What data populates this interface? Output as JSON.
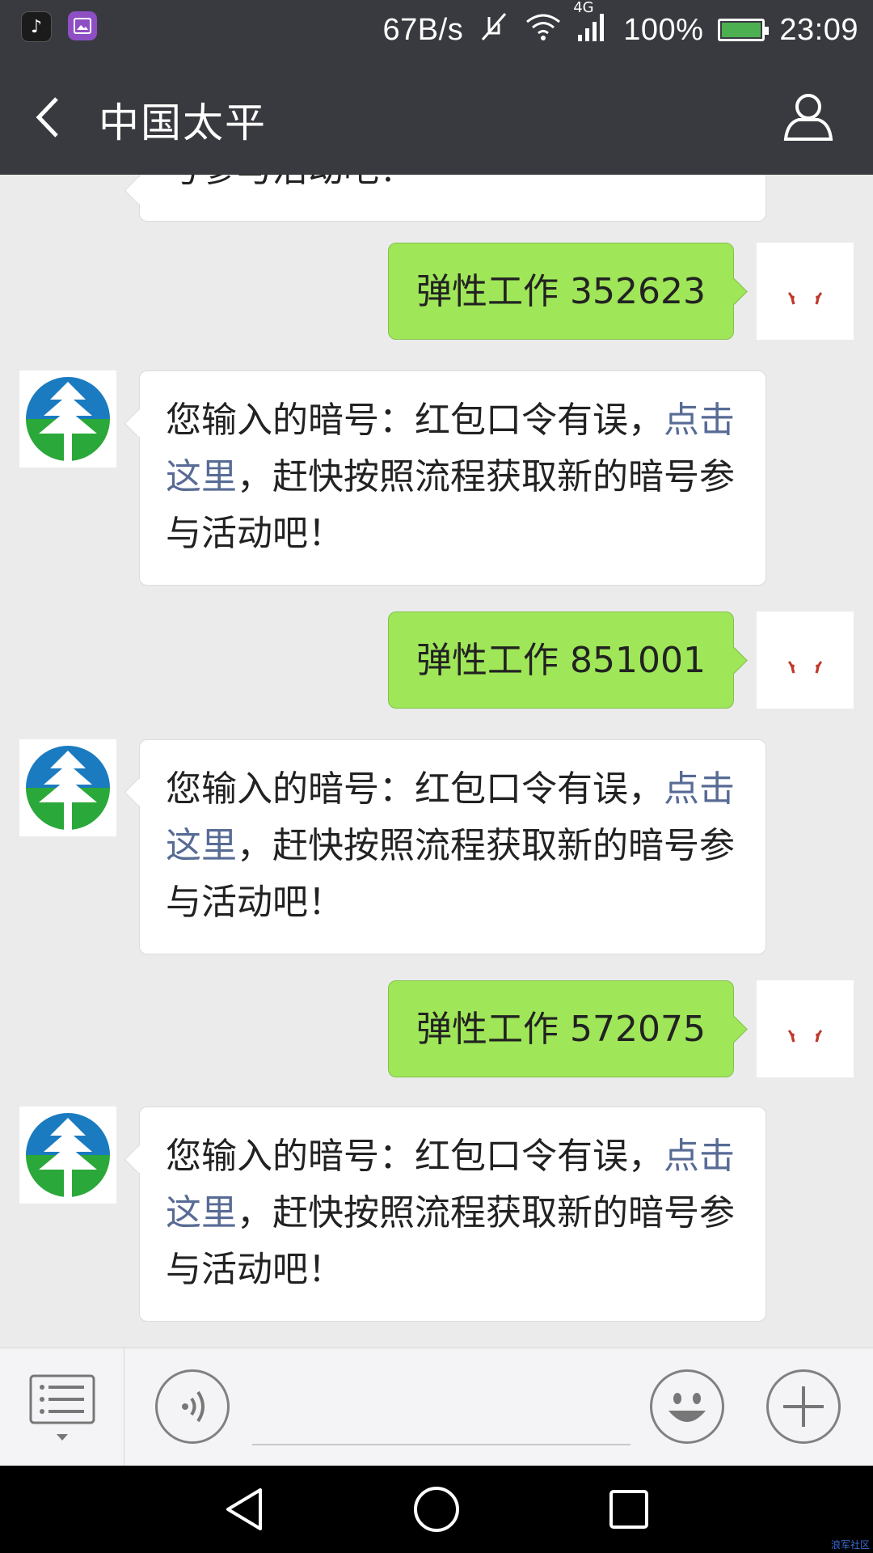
{
  "status_bar": {
    "net_speed": "67B/s",
    "network_type": "4G",
    "battery_percent": "100%",
    "time": "23:09",
    "icons": [
      "tiktok-icon",
      "gallery-icon",
      "mute-icon",
      "wifi-icon",
      "signal-icon",
      "battery-icon"
    ]
  },
  "header": {
    "title": "中国太平",
    "back_icon": "chevron-left-icon",
    "profile_icon": "user-icon"
  },
  "colors": {
    "header_bg": "#393a3f",
    "chat_bg": "#ebebeb",
    "outgoing_bubble": "#9fe658",
    "incoming_bubble": "#ffffff",
    "link": "#576b95"
  },
  "messages": [
    {
      "from": "bot",
      "text": "号参与活动吧！",
      "clipped": true
    },
    {
      "from": "me",
      "text": "弹性工作 352623"
    },
    {
      "from": "bot",
      "text_before": "您输入的暗号：红包口令有误，",
      "link": "点击这里",
      "text_after": "，赶快按照流程获取新的暗号参与活动吧！"
    },
    {
      "from": "me",
      "text": "弹性工作 851001"
    },
    {
      "from": "bot",
      "text_before": "您输入的暗号：红包口令有误，",
      "link": "点击这里",
      "text_after": "，赶快按照流程获取新的暗号参与活动吧！"
    },
    {
      "from": "me",
      "text": "弹性工作 572075"
    },
    {
      "from": "bot",
      "text_before": "您输入的暗号：红包口令有误，",
      "link": "点击这里",
      "text_after": "，赶快按照流程获取新的暗号参与活动吧！"
    }
  ],
  "input_bar": {
    "menu_icon": "menu-list-icon",
    "voice_icon": "voice-icon",
    "emoji_icon": "emoji-icon",
    "plus_icon": "plus-icon",
    "input_value": ""
  },
  "nav_bar": {
    "icons": [
      "back-triangle-icon",
      "home-circle-icon",
      "recents-square-icon"
    ]
  },
  "watermark": "浪军社区"
}
